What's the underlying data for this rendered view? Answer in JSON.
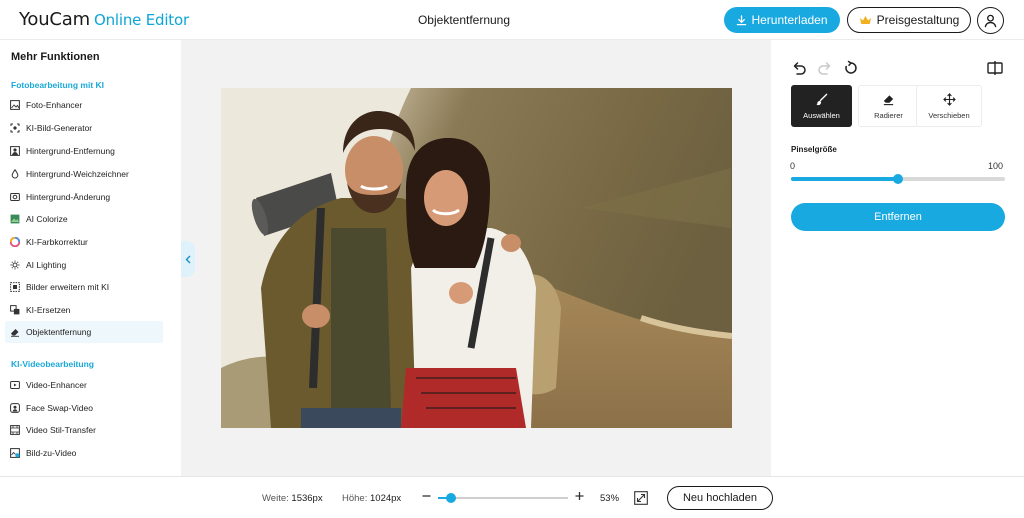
{
  "header": {
    "logo_brand": "YouCam",
    "logo_sub": "Online Editor",
    "page_title": "Objektentfernung",
    "download_label": "Herunterladen",
    "pricing_label": "Preisgestaltung",
    "icons": {
      "download": "download-icon",
      "pricing": "crown-icon",
      "account": "user-icon"
    }
  },
  "sidebar": {
    "title": "Mehr Funktionen",
    "sections": [
      {
        "title": "Fotobearbeitung mit KI",
        "items": [
          {
            "label": "Foto-Enhancer",
            "icon": "image-icon"
          },
          {
            "label": "KI-Bild-Generator",
            "icon": "ai-image-icon"
          },
          {
            "label": "Hintergrund-Entfernung",
            "icon": "background-remove-icon"
          },
          {
            "label": "Hintergrund-Weichzeichner",
            "icon": "blur-drop-icon"
          },
          {
            "label": "Hintergrund-Änderung",
            "icon": "background-change-icon"
          },
          {
            "label": "AI Colorize",
            "icon": "colorize-icon"
          },
          {
            "label": "KI-Farbkorrektur",
            "icon": "color-wheel-icon"
          },
          {
            "label": "AI Lighting",
            "icon": "light-icon"
          },
          {
            "label": "Bilder erweitern mit KI",
            "icon": "expand-icon"
          },
          {
            "label": "KI-Ersetzen",
            "icon": "replace-icon"
          },
          {
            "label": "Objektentfernung",
            "icon": "eraser-icon",
            "active": true
          }
        ]
      },
      {
        "title": "KI-Videobearbeitung",
        "items": [
          {
            "label": "Video-Enhancer",
            "icon": "video-enhance-icon"
          },
          {
            "label": "Face Swap-Video",
            "icon": "face-swap-icon"
          },
          {
            "label": "Video Stil-Transfer",
            "icon": "video-style-icon"
          },
          {
            "label": "Bild-zu-Video",
            "icon": "image-to-video-icon"
          }
        ]
      }
    ]
  },
  "panel": {
    "tools": [
      {
        "label": "Auswählen",
        "icon": "brush-icon",
        "active": true
      },
      {
        "label": "Radierer",
        "icon": "eraser-icon",
        "active": false
      },
      {
        "label": "Verschieben",
        "icon": "move-icon",
        "active": false
      }
    ],
    "brush_size_label": "Pinselgröße",
    "slider_min": "0",
    "slider_max": "100",
    "slider_value": 50,
    "remove_label": "Entfernen"
  },
  "footer": {
    "width_label": "Weite:",
    "width_value": "1536px",
    "height_label": "Höhe:",
    "height_value": "1024px",
    "zoom_value": 53,
    "zoom_text": "53%",
    "upload_label": "Neu hochladen"
  },
  "colors": {
    "accent": "#19a9e1",
    "section_title": "#19a9d8",
    "dark": "#1a1a1a"
  }
}
